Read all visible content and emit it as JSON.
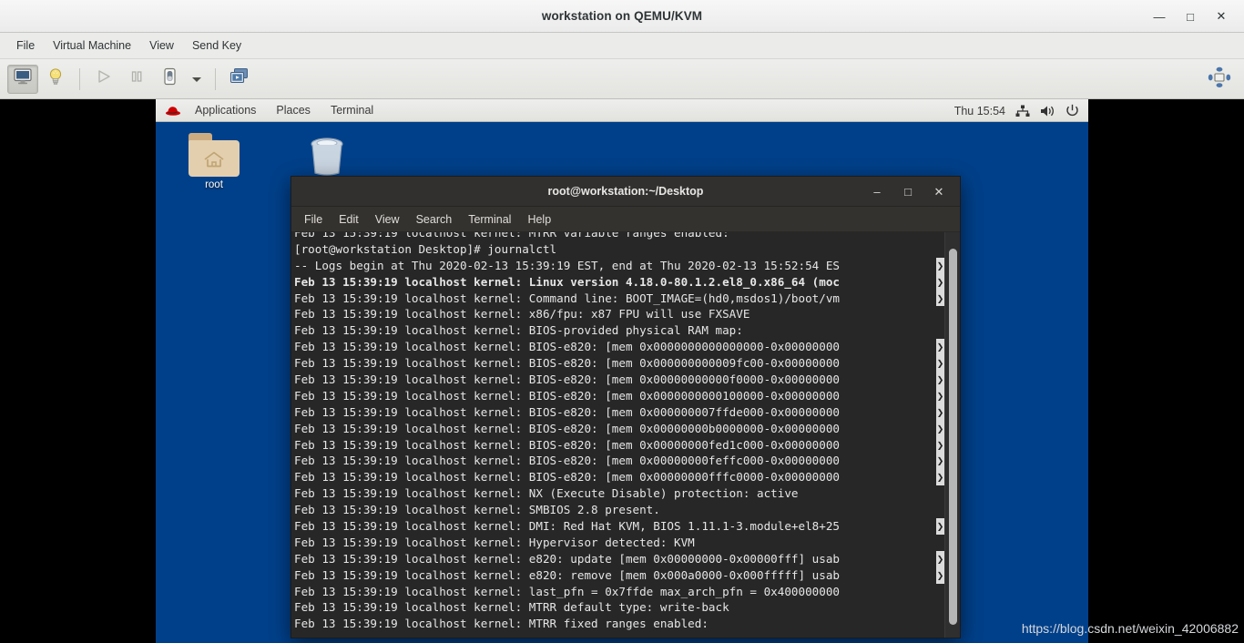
{
  "vm_window": {
    "title": "workstation on QEMU/KVM",
    "window_controls": [
      {
        "name": "minimize",
        "glyph": "—"
      },
      {
        "name": "maximize",
        "glyph": "□"
      },
      {
        "name": "close",
        "glyph": "✕"
      }
    ],
    "menubar": [
      "File",
      "Virtual Machine",
      "View",
      "Send Key"
    ],
    "toolbar": {
      "console_icon": "monitor-icon",
      "details_icon": "lightbulb-icon",
      "run_icon": "play-icon",
      "pause_icon": "pause-icon",
      "shutdown_icon": "shutdown-icon",
      "shutdown_menu_icon": "chevron-down-icon",
      "snapshot_icon": "snapshots-icon",
      "fullscreen_icon": "fullscreen-icon"
    }
  },
  "guest": {
    "panel": {
      "logo": "redhat-icon",
      "menus": [
        "Applications",
        "Places",
        "Terminal"
      ],
      "clock": "Thu 15:54",
      "tray": [
        {
          "name": "network-icon"
        },
        {
          "name": "volume-icon"
        },
        {
          "name": "power-icon"
        }
      ]
    },
    "desktop_icons": [
      {
        "name": "home-folder",
        "label": "root",
        "icon": "folder-home-icon"
      },
      {
        "name": "trash",
        "label": "",
        "icon": "trash-icon"
      }
    ]
  },
  "terminal": {
    "title": "root@workstation:~/Desktop",
    "window_controls": [
      {
        "name": "minimize",
        "glyph": "–"
      },
      {
        "name": "maximize",
        "glyph": "□"
      },
      {
        "name": "close",
        "glyph": "✕"
      }
    ],
    "menubar": [
      "File",
      "Edit",
      "View",
      "Search",
      "Terminal",
      "Help"
    ],
    "lines": [
      {
        "text": "[root@workstation Desktop]# journalctl",
        "bold": false,
        "cont": false
      },
      {
        "text": "-- Logs begin at Thu 2020-02-13 15:39:19 EST, end at Thu 2020-02-13 15:52:54 ES",
        "bold": false,
        "cont": true
      },
      {
        "text": "Feb 13 15:39:19 localhost kernel: Linux version 4.18.0-80.1.2.el8_0.x86_64 (moc",
        "bold": true,
        "cont": true
      },
      {
        "text": "Feb 13 15:39:19 localhost kernel: Command line: BOOT_IMAGE=(hd0,msdos1)/boot/vm",
        "bold": false,
        "cont": true
      },
      {
        "text": "Feb 13 15:39:19 localhost kernel: x86/fpu: x87 FPU will use FXSAVE",
        "bold": false,
        "cont": false
      },
      {
        "text": "Feb 13 15:39:19 localhost kernel: BIOS-provided physical RAM map:",
        "bold": false,
        "cont": false
      },
      {
        "text": "Feb 13 15:39:19 localhost kernel: BIOS-e820: [mem 0x0000000000000000-0x00000000",
        "bold": false,
        "cont": true
      },
      {
        "text": "Feb 13 15:39:19 localhost kernel: BIOS-e820: [mem 0x000000000009fc00-0x00000000",
        "bold": false,
        "cont": true
      },
      {
        "text": "Feb 13 15:39:19 localhost kernel: BIOS-e820: [mem 0x00000000000f0000-0x00000000",
        "bold": false,
        "cont": true
      },
      {
        "text": "Feb 13 15:39:19 localhost kernel: BIOS-e820: [mem 0x0000000000100000-0x00000000",
        "bold": false,
        "cont": true
      },
      {
        "text": "Feb 13 15:39:19 localhost kernel: BIOS-e820: [mem 0x000000007ffde000-0x00000000",
        "bold": false,
        "cont": true
      },
      {
        "text": "Feb 13 15:39:19 localhost kernel: BIOS-e820: [mem 0x00000000b0000000-0x00000000",
        "bold": false,
        "cont": true
      },
      {
        "text": "Feb 13 15:39:19 localhost kernel: BIOS-e820: [mem 0x00000000fed1c000-0x00000000",
        "bold": false,
        "cont": true
      },
      {
        "text": "Feb 13 15:39:19 localhost kernel: BIOS-e820: [mem 0x00000000feffc000-0x00000000",
        "bold": false,
        "cont": true
      },
      {
        "text": "Feb 13 15:39:19 localhost kernel: BIOS-e820: [mem 0x00000000fffc0000-0x00000000",
        "bold": false,
        "cont": true
      },
      {
        "text": "Feb 13 15:39:19 localhost kernel: NX (Execute Disable) protection: active",
        "bold": false,
        "cont": false
      },
      {
        "text": "Feb 13 15:39:19 localhost kernel: SMBIOS 2.8 present.",
        "bold": false,
        "cont": false
      },
      {
        "text": "Feb 13 15:39:19 localhost kernel: DMI: Red Hat KVM, BIOS 1.11.1-3.module+el8+25",
        "bold": false,
        "cont": true
      },
      {
        "text": "Feb 13 15:39:19 localhost kernel: Hypervisor detected: KVM",
        "bold": false,
        "cont": false
      },
      {
        "text": "Feb 13 15:39:19 localhost kernel: e820: update [mem 0x00000000-0x00000fff] usab",
        "bold": false,
        "cont": true
      },
      {
        "text": "Feb 13 15:39:19 localhost kernel: e820: remove [mem 0x000a0000-0x000fffff] usab",
        "bold": false,
        "cont": true
      },
      {
        "text": "Feb 13 15:39:19 localhost kernel: last_pfn = 0x7ffde max_arch_pfn = 0x400000000",
        "bold": false,
        "cont": false
      },
      {
        "text": "Feb 13 15:39:19 localhost kernel: MTRR default type: write-back",
        "bold": false,
        "cont": false
      },
      {
        "text": "Feb 13 15:39:19 localhost kernel: MTRR fixed ranges enabled:",
        "bold": false,
        "cont": false
      }
    ],
    "continuation_marker": "❯"
  },
  "watermark": "https://blog.csdn.net/weixin_42006882",
  "colors": {
    "desktop_blue": "#00408a",
    "terminal_bg": "#272727",
    "panel_grey": "#eeeeec"
  }
}
